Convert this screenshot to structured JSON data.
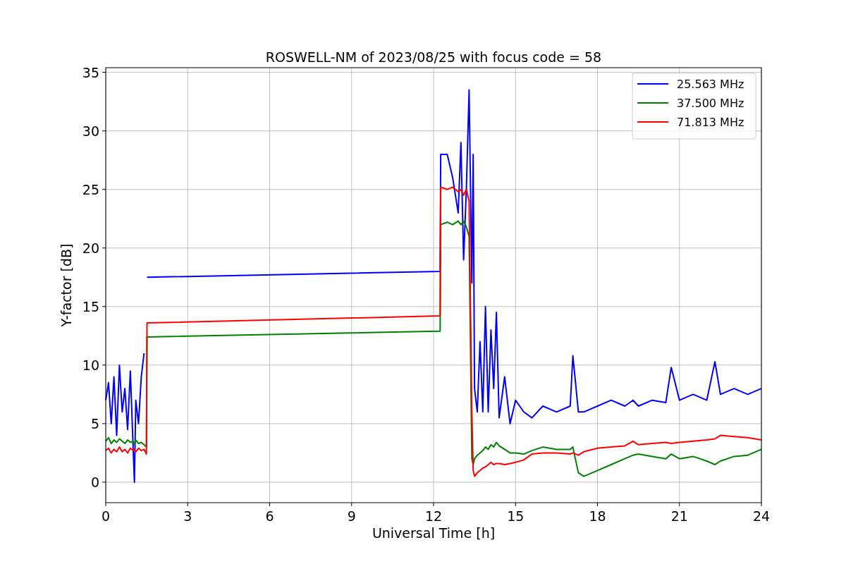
{
  "figure": {
    "chart_data": {
      "type": "line",
      "title": "ROSWELL-NM of 2023/08/25 with focus code = 58",
      "xlabel": "Universal Time [h]",
      "ylabel": "Y-factor [dB]",
      "x": [
        0,
        0.1,
        0.2,
        0.3,
        0.4,
        0.5,
        0.6,
        0.7,
        0.8,
        0.9,
        1.0,
        1.05,
        1.1,
        1.2,
        1.3,
        1.4,
        1.49,
        1.51,
        12.24,
        12.26,
        12.5,
        12.7,
        12.9,
        13.0,
        13.1,
        13.2,
        13.3,
        13.4,
        13.45,
        13.5,
        13.6,
        13.7,
        13.8,
        13.9,
        14.0,
        14.1,
        14.2,
        14.3,
        14.4,
        14.6,
        14.8,
        15.0,
        15.3,
        15.6,
        16.0,
        16.5,
        17.0,
        17.1,
        17.3,
        17.5,
        18.0,
        18.5,
        19.0,
        19.3,
        19.5,
        20.0,
        20.5,
        20.7,
        21.0,
        21.5,
        22.0,
        22.3,
        22.5,
        23.0,
        23.5,
        24.0
      ],
      "series": [
        {
          "name": "25.563 MHz",
          "color": "#0000ff",
          "values": [
            7,
            8.5,
            5,
            9,
            4,
            10,
            6,
            8,
            4.5,
            9.5,
            3,
            0,
            7,
            5,
            9,
            11,
            null,
            17.5,
            18,
            28,
            28,
            26,
            23,
            29,
            19,
            25,
            33.5,
            17,
            28,
            8,
            6,
            12,
            6,
            15,
            6,
            13,
            8,
            14.5,
            5.5,
            9,
            5,
            7,
            6,
            5.5,
            6.5,
            6,
            6.5,
            10.8,
            6,
            6,
            6.5,
            7,
            6.5,
            7,
            6.5,
            7,
            6.8,
            9.8,
            7,
            7.5,
            7,
            10.3,
            7.5,
            8,
            7.5,
            8
          ]
        },
        {
          "name": "37.500 MHz",
          "color": "#008000",
          "values": [
            3.5,
            3.8,
            3.3,
            3.6,
            3.4,
            3.7,
            3.5,
            3.3,
            3.6,
            3.4,
            3.5,
            3.2,
            3.6,
            3.3,
            3.4,
            3.2,
            3.0,
            12.4,
            12.9,
            22,
            22.2,
            22,
            22.3,
            22,
            22.3,
            21.8,
            21,
            2,
            1.5,
            2,
            2.3,
            2.5,
            2.7,
            3,
            2.8,
            3.2,
            3,
            3.4,
            3.1,
            2.8,
            2.5,
            2.5,
            2.4,
            2.7,
            3,
            2.8,
            2.8,
            3,
            0.8,
            0.5,
            1,
            1.5,
            2,
            2.3,
            2.4,
            2.2,
            2,
            2.4,
            2,
            2.2,
            1.8,
            1.5,
            1.8,
            2.2,
            2.3,
            2.8
          ]
        },
        {
          "name": "71.813 MHz",
          "color": "#ff0000",
          "values": [
            2.7,
            2.9,
            2.5,
            2.8,
            2.6,
            3,
            2.6,
            2.8,
            2.5,
            2.9,
            2.7,
            2.8,
            2.6,
            2.9,
            2.7,
            2.8,
            2.4,
            13.6,
            14.2,
            25.2,
            25,
            25.2,
            24.8,
            25,
            24.5,
            25,
            24,
            6,
            1,
            0.5,
            0.8,
            1,
            1.2,
            1.3,
            1.5,
            1.7,
            1.5,
            1.6,
            1.6,
            1.5,
            1.6,
            1.7,
            1.9,
            2.4,
            2.5,
            2.5,
            2.4,
            2.5,
            2.3,
            2.6,
            2.9,
            3,
            3.1,
            3.5,
            3.2,
            3.3,
            3.4,
            3.3,
            3.4,
            3.5,
            3.6,
            3.7,
            4,
            3.9,
            3.8,
            3.6
          ]
        }
      ],
      "grid": true,
      "legend": "upper right",
      "xlim": [
        0,
        24
      ],
      "ylim": [
        -1.75,
        35.4
      ],
      "xticks": [
        0,
        3,
        6,
        9,
        12,
        15,
        18,
        21,
        24
      ],
      "yticks": [
        0,
        5,
        10,
        15,
        20,
        25,
        30,
        35
      ]
    }
  }
}
